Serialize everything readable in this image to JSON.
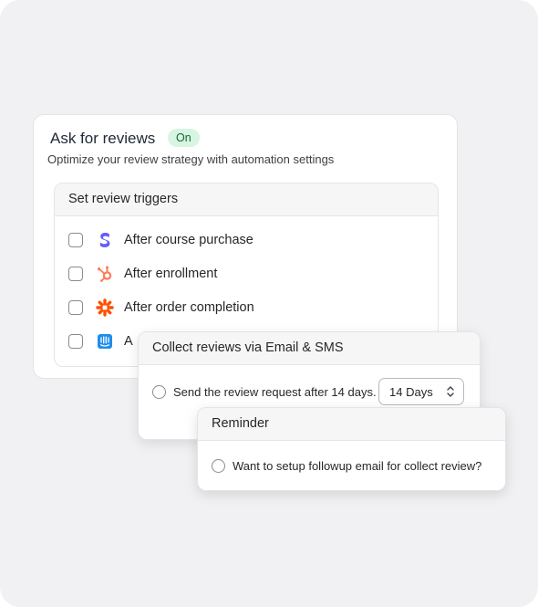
{
  "main_card": {
    "title": "Ask for reviews",
    "status_badge": "On",
    "subtitle": "Optimize your review strategy with automation settings",
    "triggers": {
      "header": "Set review triggers",
      "items": [
        {
          "label": "After course purchase",
          "icon": "stripe-icon",
          "checked": false
        },
        {
          "label": "After enrollment",
          "icon": "hubspot-icon",
          "checked": false
        },
        {
          "label": "After order completion",
          "icon": "zapier-icon",
          "checked": false
        },
        {
          "label": "A",
          "icon": "intercom-icon",
          "checked": false
        }
      ]
    }
  },
  "email_card": {
    "header": "Collect reviews via Email & SMS",
    "option_text": "Send the review request after 14 days.",
    "delay_select": {
      "value": "14 Days"
    }
  },
  "reminder_card": {
    "header": "Reminder",
    "option_text": "Want to setup followup email for collect review?"
  },
  "colors": {
    "background": "#f1f1f3",
    "badge_bg": "#d8f5e2",
    "badge_text": "#166534",
    "stripe": "#635bff",
    "hubspot": "#ff7a59",
    "zapier": "#ff4f00",
    "intercom": "#1f8ded"
  }
}
